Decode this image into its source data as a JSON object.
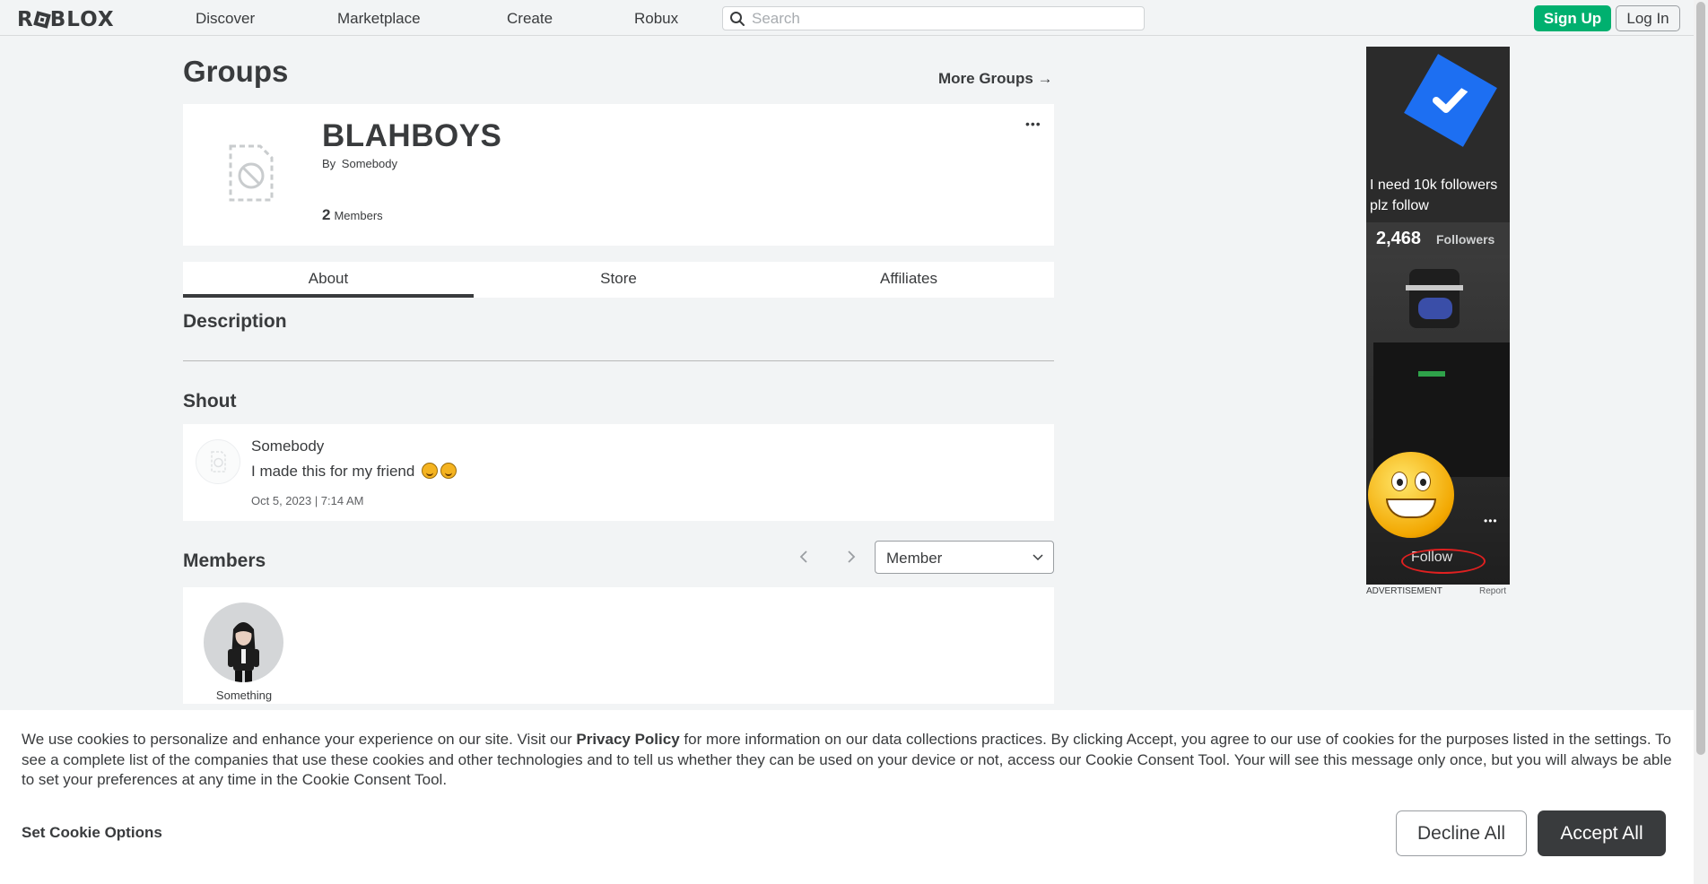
{
  "header": {
    "logo": "ROBLOX",
    "nav": [
      {
        "label": "Discover"
      },
      {
        "label": "Marketplace"
      },
      {
        "label": "Create"
      },
      {
        "label": "Robux"
      }
    ],
    "search": {
      "placeholder": "Search",
      "value": ""
    },
    "signup_label": "Sign Up",
    "login_label": "Log In"
  },
  "page": {
    "title": "Groups",
    "more_groups": "More Groups →"
  },
  "group": {
    "name": "BLAHBOYS",
    "by_prefix": "By",
    "owner": "Somebody",
    "member_count": "2",
    "members_label": "Members",
    "more_menu": "•••"
  },
  "tabs": [
    {
      "label": "About",
      "active": true
    },
    {
      "label": "Store",
      "active": false
    },
    {
      "label": "Affiliates",
      "active": false
    }
  ],
  "sections": {
    "description": "Description",
    "shout": "Shout",
    "members": "Members"
  },
  "shout": {
    "author": "Somebody",
    "text": "I made this for my friend",
    "date": "Oct 5, 2023 | 7:14 AM"
  },
  "members": {
    "role_filter": "Member",
    "list": [
      {
        "name": "Something"
      }
    ]
  },
  "ad": {
    "headline": "I need 10k followers plz follow",
    "followers_count": "2,468",
    "followers_label": "Followers",
    "more": "•••",
    "follow_label": "Follow",
    "advertisement_label": "ADVERTISEMENT",
    "report_label": "Report"
  },
  "cookie_banner": {
    "text_before": "We use cookies to personalize and enhance your experience on our site. Visit our ",
    "link_label": "Privacy Policy",
    "text_after": " for more information on our data collections practices. By clicking Accept, you agree to our use of cookies for the purposes listed in the settings. To see a complete list of the companies that use these cookies and other technologies and to tell us whether they can be used on your device or not, access our Cookie Consent Tool. Your will see this message only once, but you will always be able to set your preferences at any time in the Cookie Consent Tool.",
    "set_options_label": "Set Cookie Options",
    "decline_label": "Decline All",
    "accept_label": "Accept All"
  },
  "colors": {
    "brand_green": "#00b06f",
    "text_primary": "#393b3d",
    "page_bg": "#f2f4f5"
  }
}
